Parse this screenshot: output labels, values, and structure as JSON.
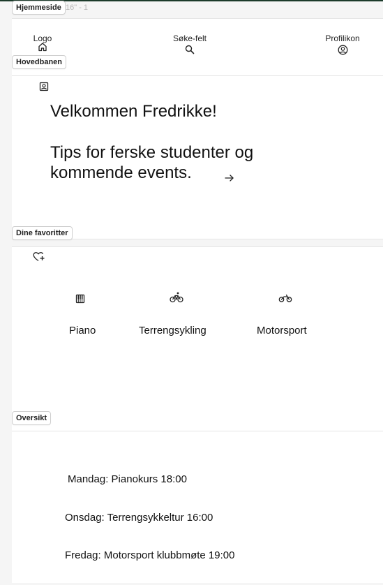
{
  "canvas": {
    "frame_hint": "16\" - 1"
  },
  "tags": {
    "home": "Hjemmeside",
    "main": "Hovedbanen",
    "favorites": "Dine favoritter",
    "overview": "Oversikt"
  },
  "header": {
    "logo_label": "Logo",
    "search_label": "Søke-felt",
    "profile_label": "Profilikon"
  },
  "main": {
    "welcome": "Velkommen Fredrikke!",
    "tips": "Tips for ferske studenter og kommende events."
  },
  "favorites": {
    "items": [
      {
        "label": "Piano",
        "icon": "piano-icon"
      },
      {
        "label": "Terrengsykling",
        "icon": "bicycle-icon"
      },
      {
        "label": "Motorsport",
        "icon": "motorbike-icon"
      }
    ]
  },
  "overview": {
    "items": [
      "Mandag: Pianokurs 18:00",
      "Onsdag: Terrengsykkeltur 16:00",
      "Fredag: Motorsport klubbmøte 19:00"
    ]
  }
}
